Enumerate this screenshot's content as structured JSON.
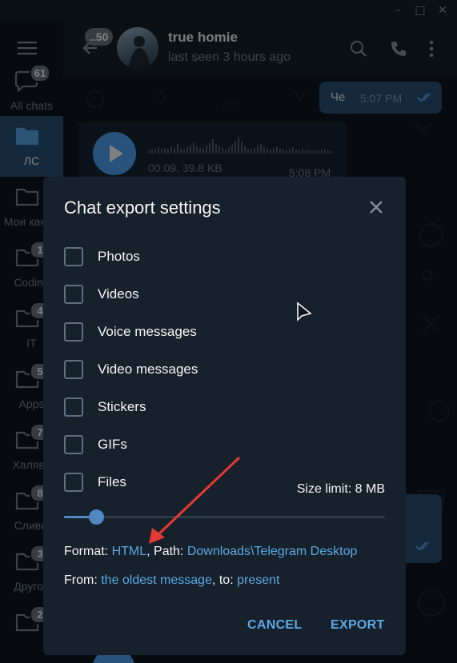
{
  "window": {
    "minimize": "–",
    "maximize": "□",
    "close": "✕"
  },
  "sidebar": {
    "items": [
      {
        "label": "All chats",
        "badge": "61",
        "icon": "chats-icon"
      },
      {
        "label": "ЛС",
        "badge": "",
        "icon": "folder-icon"
      },
      {
        "label": "Мои канал",
        "badge": "",
        "icon": "folder-icon"
      },
      {
        "label": "Coding",
        "badge": "1",
        "icon": "folder-icon"
      },
      {
        "label": "IT",
        "badge": "4",
        "icon": "folder-icon"
      },
      {
        "label": "Apps",
        "badge": "5",
        "icon": "folder-icon"
      },
      {
        "label": "Халява",
        "badge": "7",
        "icon": "folder-icon"
      },
      {
        "label": "Сливы",
        "badge": "8",
        "icon": "folder-icon"
      },
      {
        "label": "Другое",
        "badge": "3",
        "icon": "folder-icon"
      },
      {
        "label": "",
        "badge": "2",
        "icon": "folder-icon"
      }
    ]
  },
  "header": {
    "back_badge": "..50",
    "chat_name": "true homie",
    "status": "last seen 3 hours ago"
  },
  "messages": {
    "out1_text": "Че",
    "out1_time": "5:07 PM",
    "voice_meta": "00:09, 39.8 KB",
    "voice_time": "5:08 PM"
  },
  "dialog": {
    "title": "Chat export settings",
    "options": [
      {
        "label": "Photos",
        "checked": false
      },
      {
        "label": "Videos",
        "checked": false
      },
      {
        "label": "Voice messages",
        "checked": false
      },
      {
        "label": "Video messages",
        "checked": false
      },
      {
        "label": "Stickers",
        "checked": false
      },
      {
        "label": "GIFs",
        "checked": false
      },
      {
        "label": "Files",
        "checked": false
      }
    ],
    "size_limit": "Size limit: 8 MB",
    "size_fraction": 0.1,
    "format_label": "Format: ",
    "format_value": "HTML",
    "path_label": ", Path: ",
    "path_value": "Downloads\\Telegram Desktop",
    "from_label": "From: ",
    "from_value": "the oldest message",
    "to_label": ", to: ",
    "to_value": "present",
    "cancel": "CANCEL",
    "export": "EXPORT"
  },
  "colors": {
    "accent": "#5288c1",
    "link": "#5aa9e6",
    "annotation_arrow": "#e53935"
  }
}
